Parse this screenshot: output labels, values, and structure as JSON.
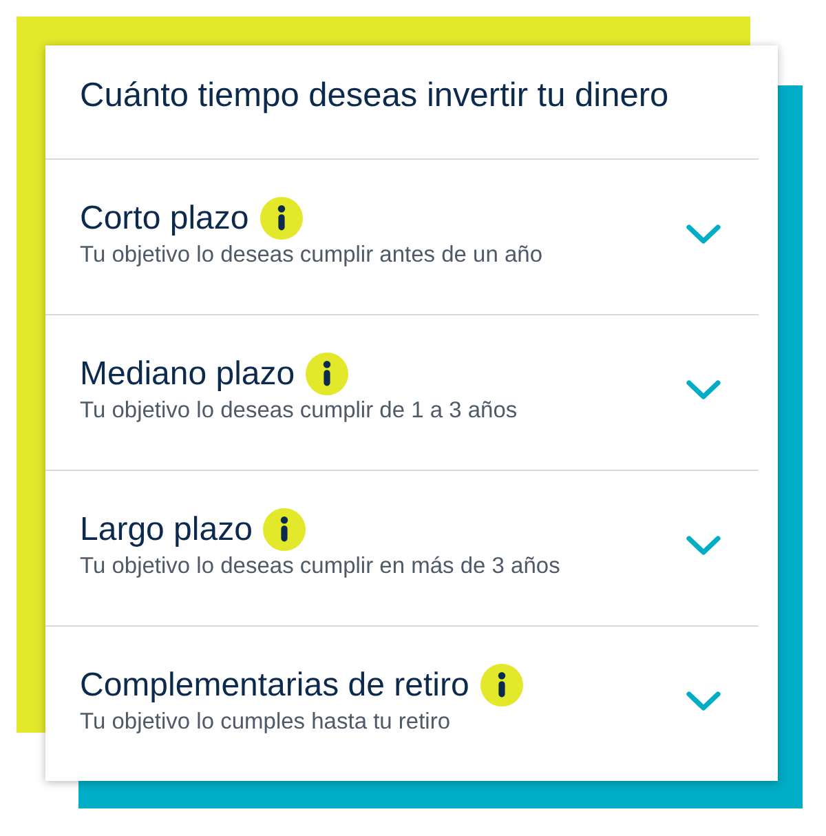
{
  "header": {
    "title": "Cuánto tiempo deseas invertir tu dinero"
  },
  "options": [
    {
      "title": "Corto plazo",
      "description": "Tu objetivo lo deseas cumplir antes de un año",
      "expanded": false
    },
    {
      "title": "Mediano plazo",
      "description": "Tu objetivo lo deseas cumplir de 1 a 3 años",
      "expanded": false
    },
    {
      "title": "Largo plazo",
      "description": "Tu objetivo lo deseas cumplir en más de 3 años",
      "expanded": false
    },
    {
      "title": "Complementarias de retiro",
      "description": "Tu objetivo lo cumples hasta tu retiro",
      "expanded": false
    }
  ]
}
